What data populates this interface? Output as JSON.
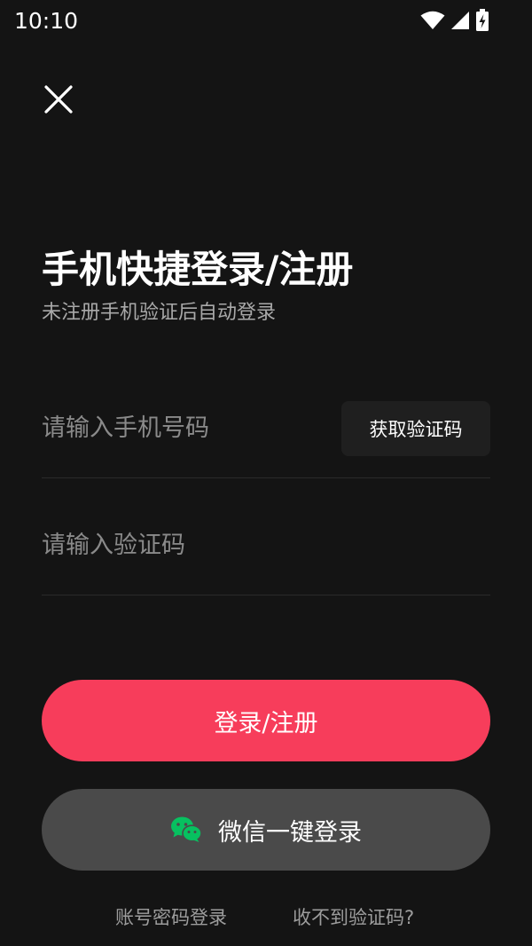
{
  "status_bar": {
    "time": "10:10",
    "icons": [
      "wifi-icon",
      "signal-icon",
      "battery-charging-icon"
    ]
  },
  "header": {
    "close_icon": "close-icon"
  },
  "main": {
    "title": "手机快捷登录/注册",
    "subtitle": "未注册手机验证后自动登录"
  },
  "form": {
    "phone": {
      "value": "",
      "placeholder": "请输入手机号码"
    },
    "get_code_label": "获取验证码",
    "code": {
      "value": "",
      "placeholder": "请输入验证码"
    },
    "login_label": "登录/注册",
    "wechat_label": "微信一键登录"
  },
  "footer": {
    "password_login": "账号密码登录",
    "no_code": "收不到验证码?"
  },
  "colors": {
    "background": "#141414",
    "primary": "#f73d5b",
    "secondary_button": "#4a4a4a",
    "wechat_green": "#07c160"
  }
}
